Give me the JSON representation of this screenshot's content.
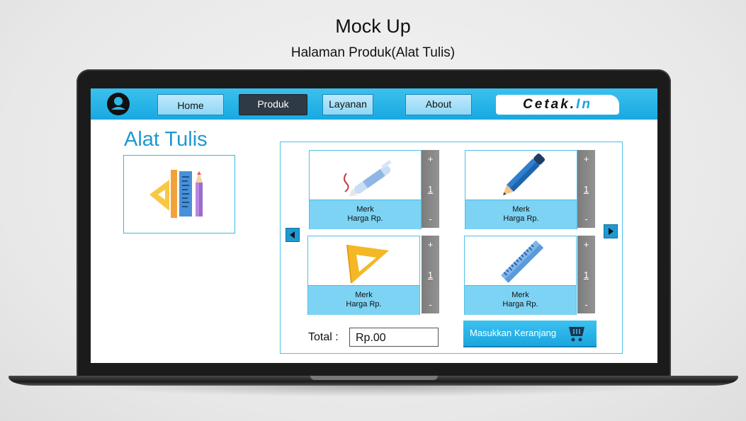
{
  "page": {
    "title": "Mock Up",
    "subtitle": "Halaman Produk(Alat Tulis)"
  },
  "nav": {
    "items": [
      {
        "label": "Home",
        "active": false
      },
      {
        "label": "Produk",
        "active": true
      },
      {
        "label": "Layanan",
        "active": false
      },
      {
        "label": "About",
        "active": false
      }
    ],
    "brand_main": "Cetak.",
    "brand_accent": "In",
    "user_icon": "user-circle-icon"
  },
  "category": {
    "title": "Alat Tulis",
    "icon": "stationery-icon"
  },
  "products": [
    {
      "icon": "pen-icon",
      "brand": "Merk",
      "price": "Harga Rp.",
      "qty": "1",
      "plus": "+",
      "minus": "-"
    },
    {
      "icon": "pencil-icon",
      "brand": "Merk",
      "price": "Harga Rp.",
      "qty": "1",
      "plus": "+",
      "minus": "-"
    },
    {
      "icon": "triangle-ruler-icon",
      "brand": "Merk",
      "price": "Harga Rp.",
      "qty": "1",
      "plus": "+",
      "minus": "-"
    },
    {
      "icon": "ruler-icon",
      "brand": "Merk",
      "price": "Harga Rp.",
      "qty": "1",
      "plus": "+",
      "minus": "-"
    }
  ],
  "cart": {
    "total_label": "Total :",
    "total_value": "Rp.00",
    "button_label": "Masukkan Keranjang",
    "button_icon": "shopping-cart-icon"
  },
  "colors": {
    "nav": "#17a9e2",
    "accent": "#1f98d2",
    "active_tab": "#2e3a45",
    "card_info": "#7dd3f4",
    "qty_bar": "#888888"
  }
}
